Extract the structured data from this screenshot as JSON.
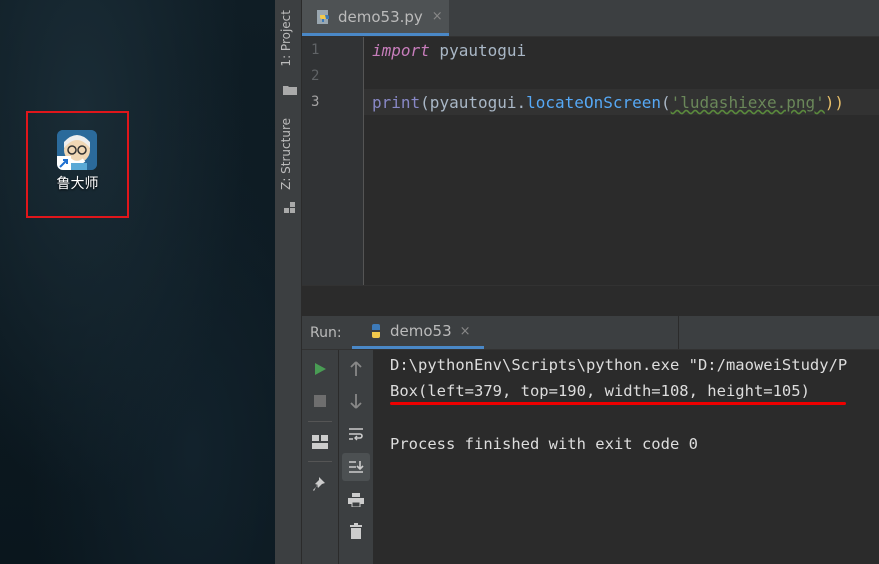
{
  "desktop": {
    "icon_label": "鲁大师"
  },
  "ide": {
    "side_tabs": {
      "project": "1: Project",
      "structure": "Z: Structure"
    },
    "editor_tab": {
      "filename": "demo53.py",
      "close": "×"
    },
    "line_numbers": [
      "1",
      "2",
      "3"
    ],
    "code": {
      "line1_kw": "import",
      "line1_mod": " pyautogui",
      "line3_print": "print",
      "line3_open": "(pyautogui.",
      "line3_method": "locateOnScreen",
      "line3_paren": "(",
      "line3_str": "'ludashiexe.png'",
      "line3_close": "))"
    },
    "run": {
      "label": "Run:",
      "tab_name": "demo53",
      "close": "×"
    },
    "console": {
      "line1": "D:\\pythonEnv\\Scripts\\python.exe \"D:/maoweiStudy/P",
      "line2": "Box(left=379, top=190, width=108, height=105)",
      "line3": "Process finished with exit code 0"
    }
  }
}
